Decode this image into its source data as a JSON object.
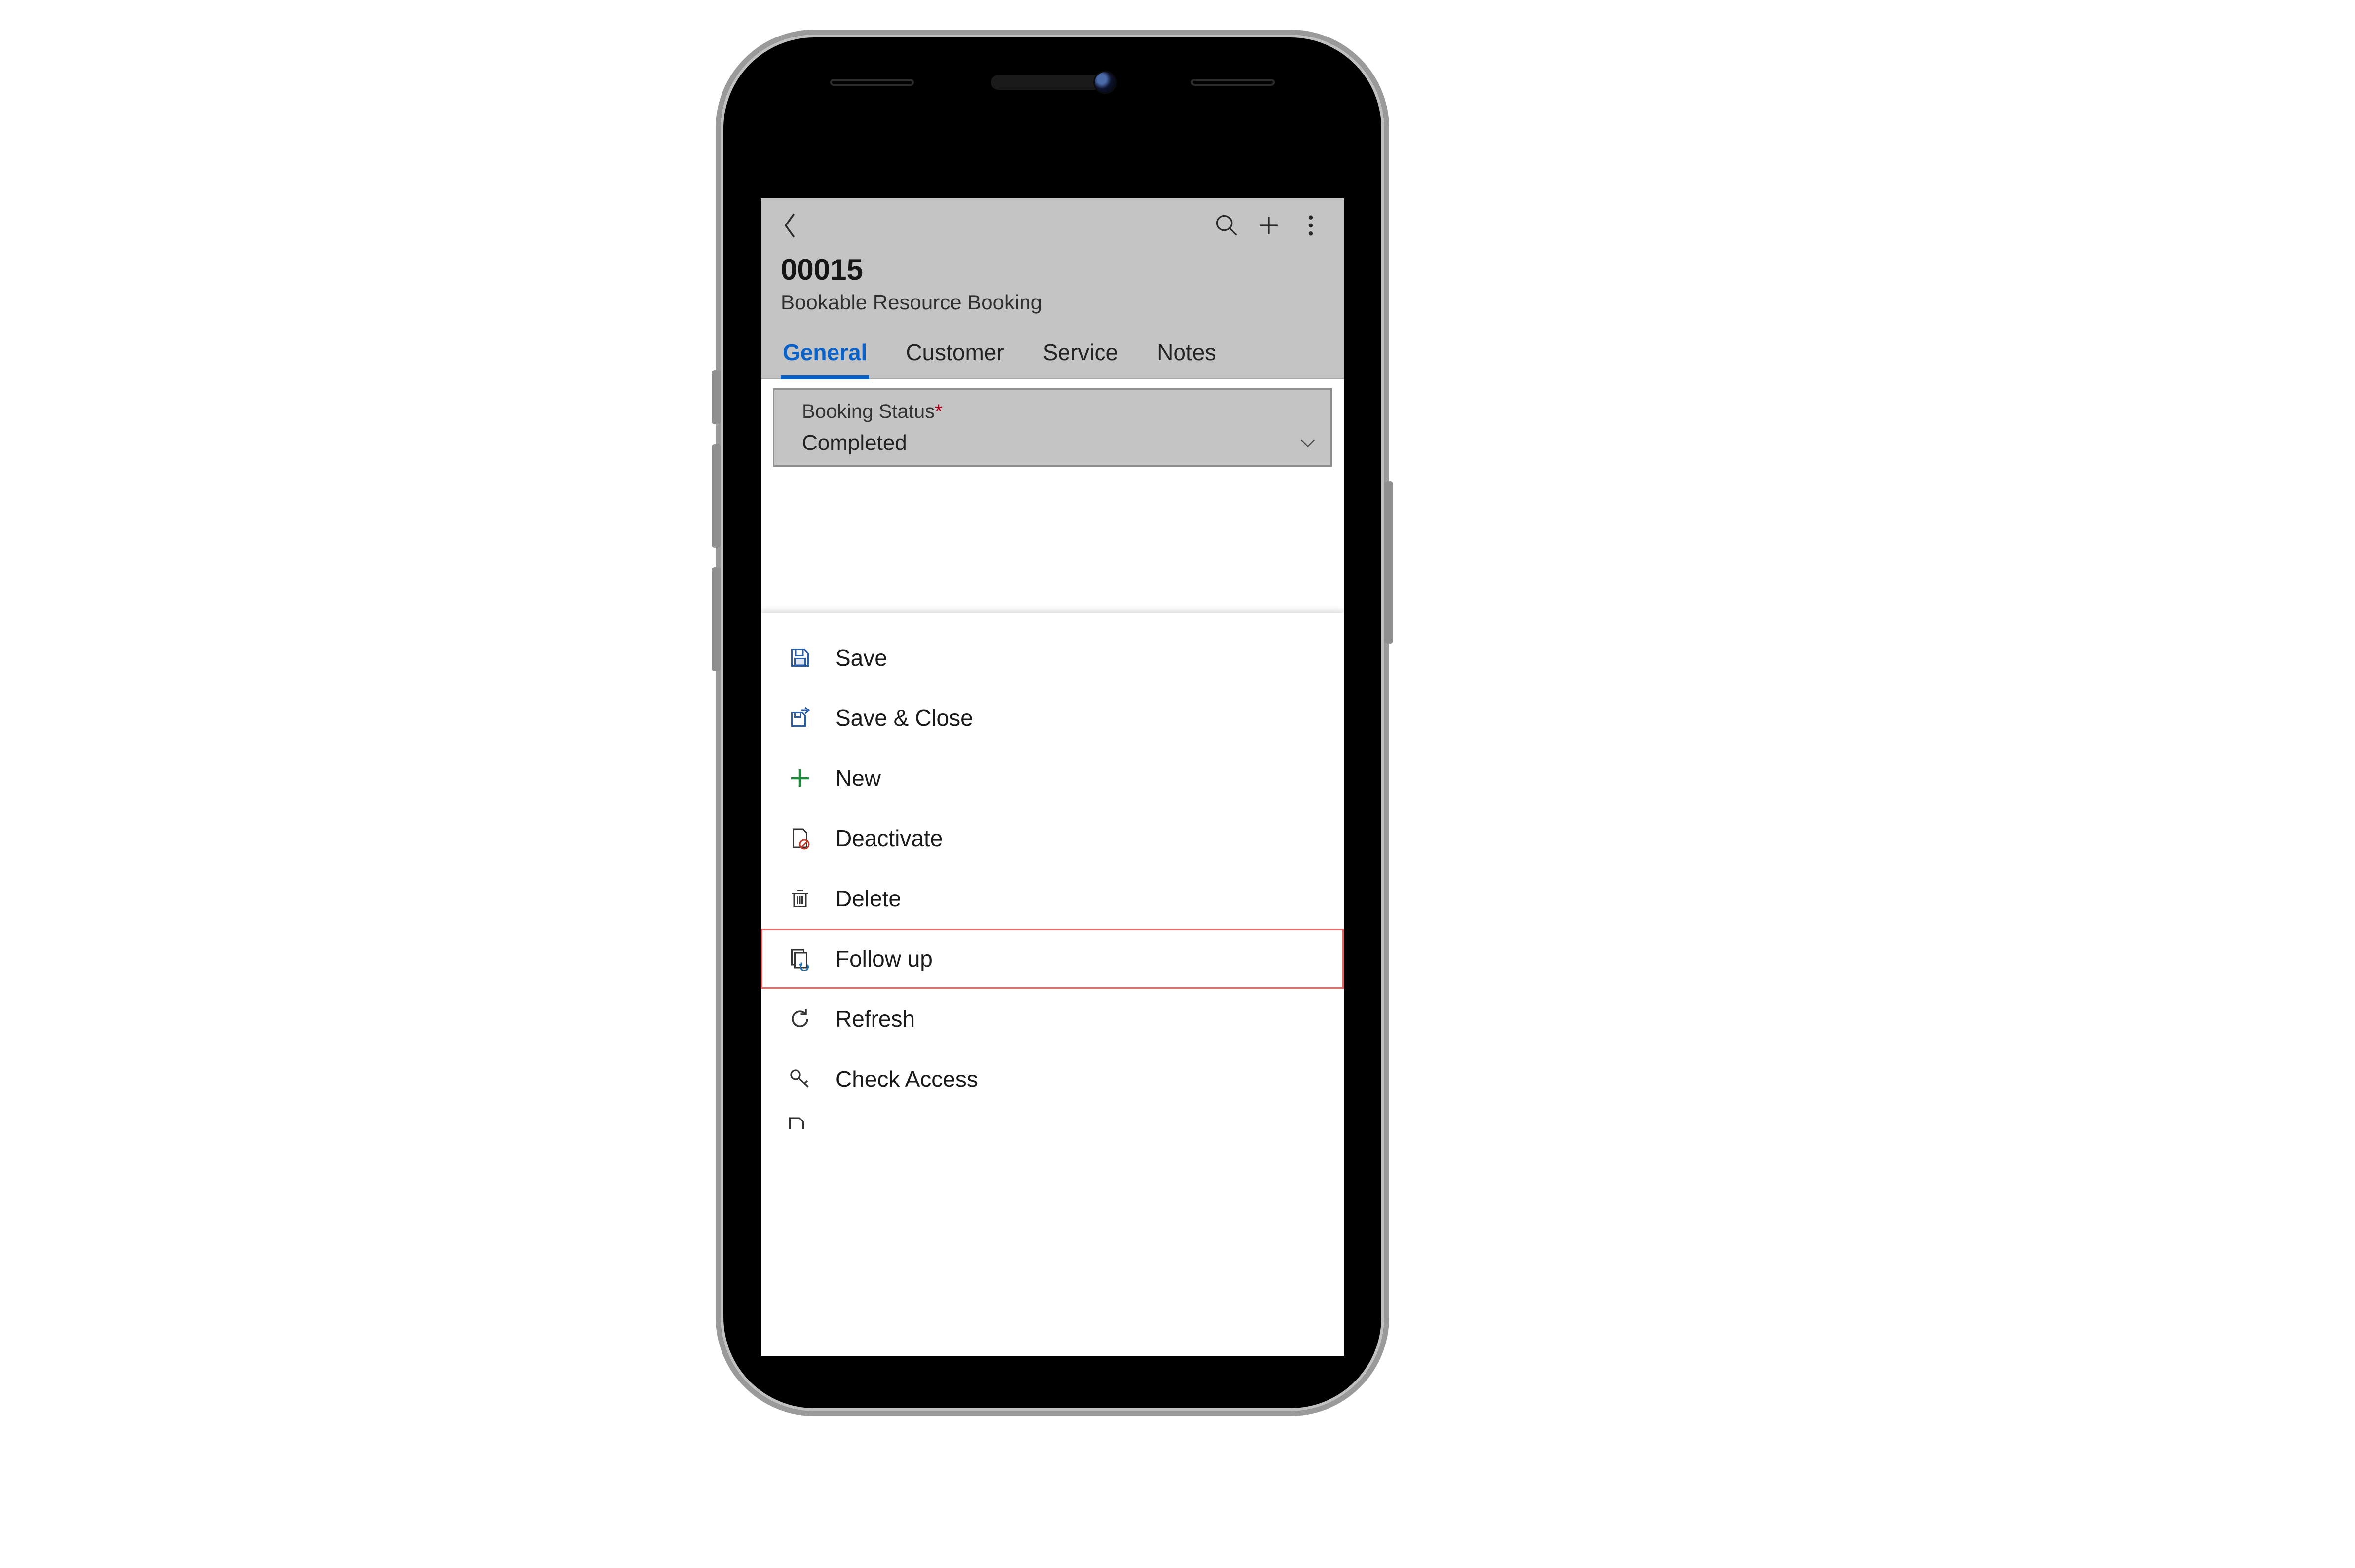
{
  "header": {
    "title": "00015",
    "subtitle": "Bookable Resource Booking"
  },
  "tabs": [
    {
      "label": "General",
      "active": true
    },
    {
      "label": "Customer",
      "active": false
    },
    {
      "label": "Service",
      "active": false
    },
    {
      "label": "Notes",
      "active": false
    }
  ],
  "form": {
    "booking_status_label": "Booking Status",
    "booking_status_required": "*",
    "booking_status_value": "Completed"
  },
  "menu": {
    "save": "Save",
    "save_close": "Save & Close",
    "new": "New",
    "deactivate": "Deactivate",
    "delete": "Delete",
    "follow_up": "Follow up",
    "refresh": "Refresh",
    "check_access": "Check Access"
  },
  "highlighted_menu_item": "follow_up"
}
